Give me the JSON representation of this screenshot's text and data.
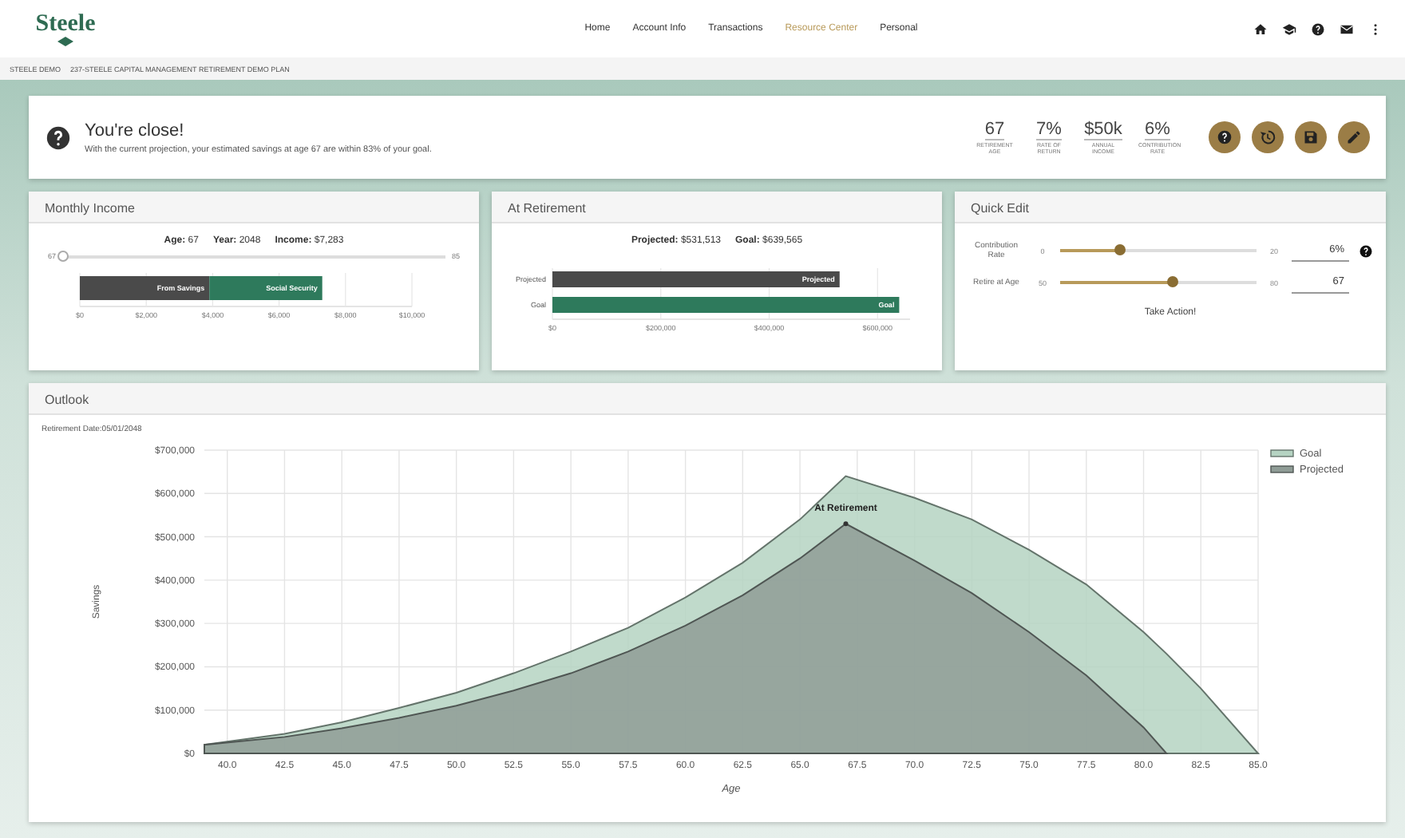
{
  "nav": {
    "logo": "Steele",
    "links": [
      {
        "label": "Home",
        "selected": false
      },
      {
        "label": "Account Info",
        "selected": false
      },
      {
        "label": "Transactions",
        "selected": false
      },
      {
        "label": "Resource Center",
        "selected": true
      },
      {
        "label": "Personal",
        "selected": false
      }
    ],
    "icons": [
      {
        "kind": "home"
      },
      {
        "kind": "school"
      },
      {
        "kind": "help"
      },
      {
        "kind": "mail"
      },
      {
        "kind": "more"
      }
    ]
  },
  "breadcrumb": [
    "STEELE DEMO",
    "237-STEELE CAPITAL MANAGEMENT RETIREMENT DEMO PLAN"
  ],
  "summary": {
    "title": "You're close!",
    "message": "With the current projection, your estimated savings at age 67 are within 83% of your goal.",
    "stats": [
      {
        "value": "67",
        "label": "RETIREMENT AGE"
      },
      {
        "value": "7%",
        "label": "RATE OF RETURN"
      },
      {
        "value": "$50k",
        "label": "ANNUAL INCOME"
      },
      {
        "value": "6%",
        "label": "CONTRIBUTION RATE"
      }
    ],
    "buttons": [
      {
        "kind": "help"
      },
      {
        "kind": "history"
      },
      {
        "kind": "save"
      },
      {
        "kind": "edit"
      }
    ]
  },
  "monthly_income": {
    "title": "Monthly Income",
    "facts": [
      {
        "label": "Age:",
        "value": "67"
      },
      {
        "label": "Year:",
        "value": "2048"
      },
      {
        "label": "Income:",
        "value": "$7,283"
      }
    ],
    "slider": {
      "min": "67",
      "max": "85",
      "level": 0
    },
    "chart_data": {
      "type": "bar",
      "orientation": "horizontal",
      "stacked": true,
      "grid": true,
      "xlim": [
        0,
        10000
      ],
      "xticks": [
        {
          "value": 0,
          "label": "$0"
        },
        {
          "value": 2000,
          "label": "$2,000"
        },
        {
          "value": 4000,
          "label": "$4,000"
        },
        {
          "value": 6000,
          "label": "$6,000"
        },
        {
          "value": 8000,
          "label": "$8,000"
        },
        {
          "value": 10000,
          "label": "$10,000"
        }
      ],
      "series": [
        {
          "name": "From Savings",
          "color": "#4a4a4a",
          "values": [
            3900
          ]
        },
        {
          "name": "Social Security",
          "color": "#2e7a5c",
          "values": [
            3400
          ]
        }
      ]
    }
  },
  "at_retirement": {
    "title": "At Retirement",
    "facts": [
      {
        "label": "Projected:",
        "value": "$531,513"
      },
      {
        "label": "Goal:",
        "value": "$639,565"
      }
    ],
    "chart_data": {
      "type": "bar",
      "orientation": "horizontal",
      "grid": true,
      "xlim": [
        0,
        660000
      ],
      "categories": [
        "Projected",
        "Goal"
      ],
      "xticks": [
        {
          "value": 0,
          "label": "$0"
        },
        {
          "value": 200000,
          "label": "$200,000"
        },
        {
          "value": 400000,
          "label": "$400,000"
        },
        {
          "value": 600000,
          "label": "$600,000"
        }
      ],
      "series": [
        {
          "name": "Projected",
          "color": "#4a4a4a",
          "values": [
            530000,
            null
          ]
        },
        {
          "name": "Goal",
          "color": "#2e7a5c",
          "values": [
            null,
            640000
          ]
        }
      ]
    }
  },
  "quick_edit": {
    "title": "Quick Edit",
    "sliders": [
      {
        "label": "Contribution Rate",
        "min": "0",
        "max": "20",
        "level": 0.3,
        "value": "6%",
        "help": true
      },
      {
        "label": "Retire at Age",
        "min": "50",
        "max": "80",
        "level": 0.57,
        "value": "67",
        "help": false
      }
    ],
    "action": "Take Action!"
  },
  "outlook": {
    "title": "Outlook",
    "subtitle": "Retirement Date:05/01/2048",
    "chart_data": {
      "type": "area",
      "grid": true,
      "legend": "top-right",
      "xlabel": "Age",
      "ylabel": "Savings",
      "xlim": [
        39,
        85
      ],
      "ylim": [
        0,
        700000
      ],
      "x": [
        39,
        42.5,
        45,
        47.5,
        50,
        52.5,
        55,
        57.5,
        60,
        62.5,
        65,
        67,
        70,
        72.5,
        75,
        77.5,
        80,
        81,
        82.5,
        85
      ],
      "xticks": [
        {
          "value": 40,
          "label": "40.0"
        },
        {
          "value": 42.5,
          "label": "42.5"
        },
        {
          "value": 45,
          "label": "45.0"
        },
        {
          "value": 47.5,
          "label": "47.5"
        },
        {
          "value": 50,
          "label": "50.0"
        },
        {
          "value": 52.5,
          "label": "52.5"
        },
        {
          "value": 55,
          "label": "55.0"
        },
        {
          "value": 57.5,
          "label": "57.5"
        },
        {
          "value": 60,
          "label": "60.0"
        },
        {
          "value": 62.5,
          "label": "62.5"
        },
        {
          "value": 65,
          "label": "65.0"
        },
        {
          "value": 67.5,
          "label": "67.5"
        },
        {
          "value": 70,
          "label": "70.0"
        },
        {
          "value": 72.5,
          "label": "72.5"
        },
        {
          "value": 75,
          "label": "75.0"
        },
        {
          "value": 77.5,
          "label": "77.5"
        },
        {
          "value": 80,
          "label": "80.0"
        },
        {
          "value": 82.5,
          "label": "82.5"
        },
        {
          "value": 85,
          "label": "85.0"
        }
      ],
      "yticks": [
        {
          "value": 0,
          "label": "$0"
        },
        {
          "value": 100000,
          "label": "$100,000"
        },
        {
          "value": 200000,
          "label": "$200,000"
        },
        {
          "value": 300000,
          "label": "$300,000"
        },
        {
          "value": 400000,
          "label": "$400,000"
        },
        {
          "value": 500000,
          "label": "$500,000"
        },
        {
          "value": 600000,
          "label": "$600,000"
        },
        {
          "value": 700000,
          "label": "$700,000"
        }
      ],
      "series": [
        {
          "name": "Goal",
          "color": "#b5d3c2",
          "values": [
            20000,
            45000,
            72000,
            105000,
            140000,
            185000,
            235000,
            290000,
            360000,
            440000,
            540000,
            640000,
            590000,
            540000,
            470000,
            390000,
            280000,
            230000,
            150000,
            0
          ]
        },
        {
          "name": "Projected",
          "color": "#8f9c96",
          "values": [
            20000,
            38000,
            58000,
            82000,
            110000,
            145000,
            185000,
            235000,
            295000,
            365000,
            450000,
            530000,
            445000,
            370000,
            280000,
            180000,
            60000,
            0,
            null,
            null
          ]
        }
      ],
      "annotations": [
        {
          "x": 67,
          "y": 530000,
          "text": "At Retirement"
        }
      ]
    }
  }
}
